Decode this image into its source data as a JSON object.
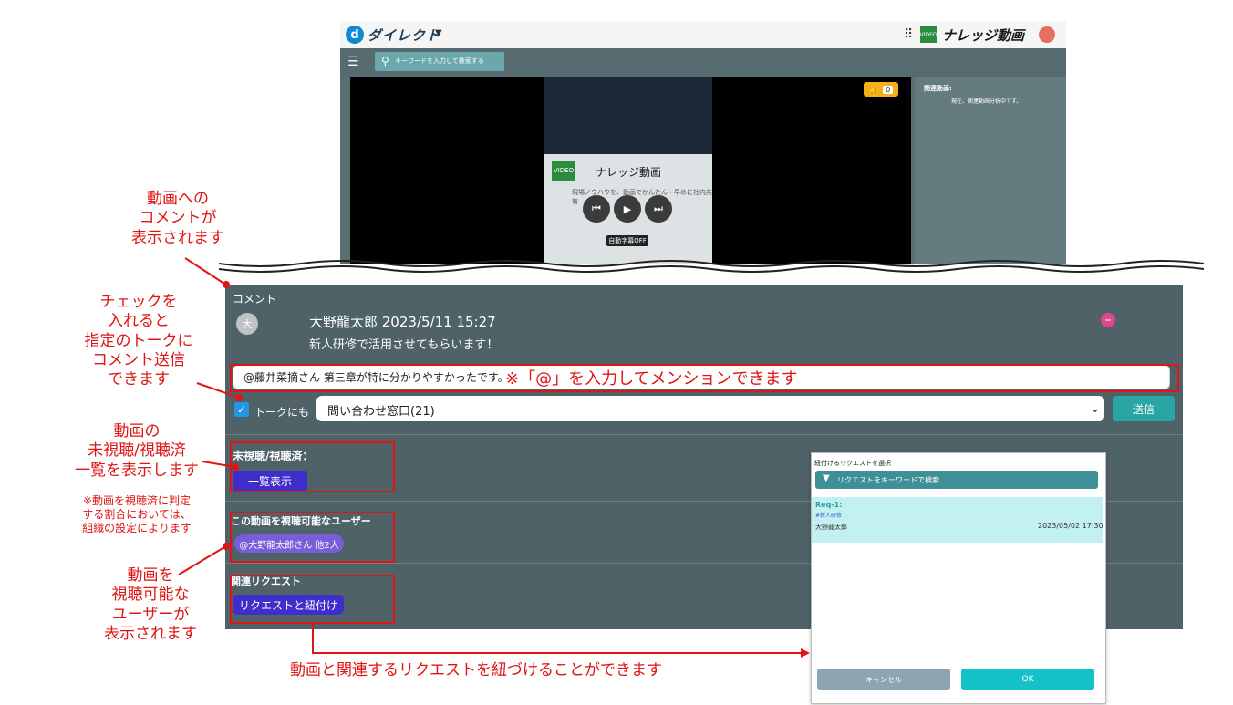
{
  "app": {
    "logo_letter": "d",
    "logo_text": "ダイレクト",
    "grid_icon": "grid-icon",
    "video_logo": "VIDEO",
    "brand": "ナレッジ動画",
    "avatar_initial": "",
    "search_placeholder": "キーワードを入力して検索する",
    "video_title": "ナレッジ動画",
    "video_sub": "現場ノウハウを、動画でかんたん・早めに社内共有",
    "caption_label": "自動字幕OFF",
    "like_count": "0",
    "related_title": "関連動画:",
    "related_text": "現在、関連動画分析中です。"
  },
  "comment": {
    "header": "コメント",
    "avatar_initial": "大",
    "meta": "大野龍太郎 2023/5/11 15:27",
    "body": "新人研修で活用させてもらいます！",
    "input_value": "@藤井菜摘さん 第三章が特に分かりやすかったです。",
    "mention_note": "※「@」を入力してメンションできます",
    "talk_label": "トークにも",
    "talk_selected": "問い合わせ窓口(21)",
    "send_label": "送信"
  },
  "watch": {
    "label": "未視聴/視聴済：",
    "button": "一覧表示"
  },
  "viewers": {
    "label": "この動画を視聴可能なユーザー",
    "badge": "@大野龍太郎さん 他2人"
  },
  "related_request": {
    "label": "関連リクエスト",
    "button": "リクエストと紐付け"
  },
  "dialog": {
    "title": "紐付けるリクエストを選択",
    "search_placeholder": "リクエストをキーワードで検索",
    "item": {
      "id": "Req-1:",
      "tag": "#新人研修",
      "user": "大野龍太郎",
      "date": "2023/05/02 17:30"
    },
    "cancel": "キャンセル",
    "ok": "OK"
  },
  "annotations": {
    "comments_shown": [
      "動画への",
      "コメントが",
      "表示されます"
    ],
    "check_to_send": [
      "チェックを",
      "入れると",
      "指定のトークに",
      "コメント送信",
      "できます"
    ],
    "watch_list": [
      "動画の",
      "未視聴/視聴済",
      "一覧を表示します"
    ],
    "watch_note": [
      "※動画を視聴済に判定",
      "する割合においては、",
      "組織の設定によります"
    ],
    "viewers_shown": [
      "動画を",
      "視聴可能な",
      "ユーザーが",
      "表示されます"
    ],
    "link_request": "動画と関連するリクエストを紐づけることができます"
  }
}
